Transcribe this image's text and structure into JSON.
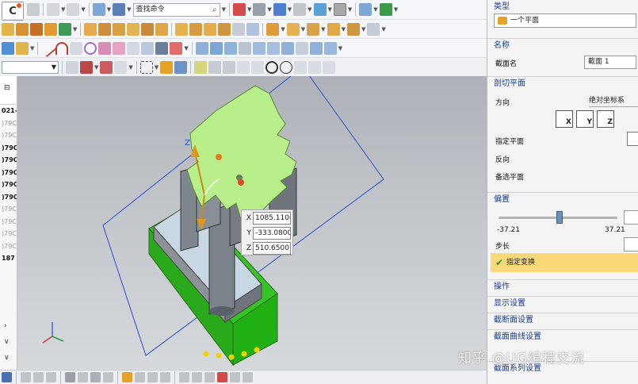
{
  "toolbar": {
    "search_placeholder": "查找命令",
    "logo_glyph": "C"
  },
  "left_list": {
    "header": "",
    "values": [
      "021-",
      ")79C",
      ")79C",
      ")79C",
      ")79C",
      ")79C",
      ")79C",
      ")79C",
      ")79C",
      ")79C",
      ")79C",
      ")79C",
      "187"
    ]
  },
  "coords": {
    "x_label": "X",
    "x_value": "1085.1100",
    "y_label": "Y",
    "y_value": "-333.0800",
    "z_label": "Z",
    "z_value": "510.6500",
    "axis_label": "Z"
  },
  "panel": {
    "type_heading": "类型",
    "type_value": "一个平面",
    "name_heading": "名称",
    "section_name_label": "截面名",
    "section_name_value": "截面 1",
    "cut_plane_heading": "剖切平面",
    "direction_label": "方向",
    "direction_value": "绝对坐标系",
    "axis_x": "X",
    "axis_y": "Y",
    "axis_z": "Z",
    "specify_plane_label": "指定平面",
    "reverse_label": "反向",
    "alt_plane_label": "备选平面",
    "offset_heading": "偏置",
    "offset_min": "-37.21",
    "offset_max": "37.21",
    "offset_fraction": 0.51,
    "step_label": "步长",
    "specify_transform": "指定变换",
    "ops_heading": "操作",
    "display_settings": "显示设置",
    "section_settings": "截断面设置",
    "section_curve_settings": "截面曲线设置",
    "section_series_settings": "截面系列设置"
  },
  "watermark": "知乎 @UG编程交流",
  "colors": {
    "panel_heading": "#1a3d8f",
    "specify_bar": "#fbd97a",
    "part_green": "#b8ef8a",
    "base_green": "#2fbf1e",
    "metal_gray": "#7b8088"
  }
}
